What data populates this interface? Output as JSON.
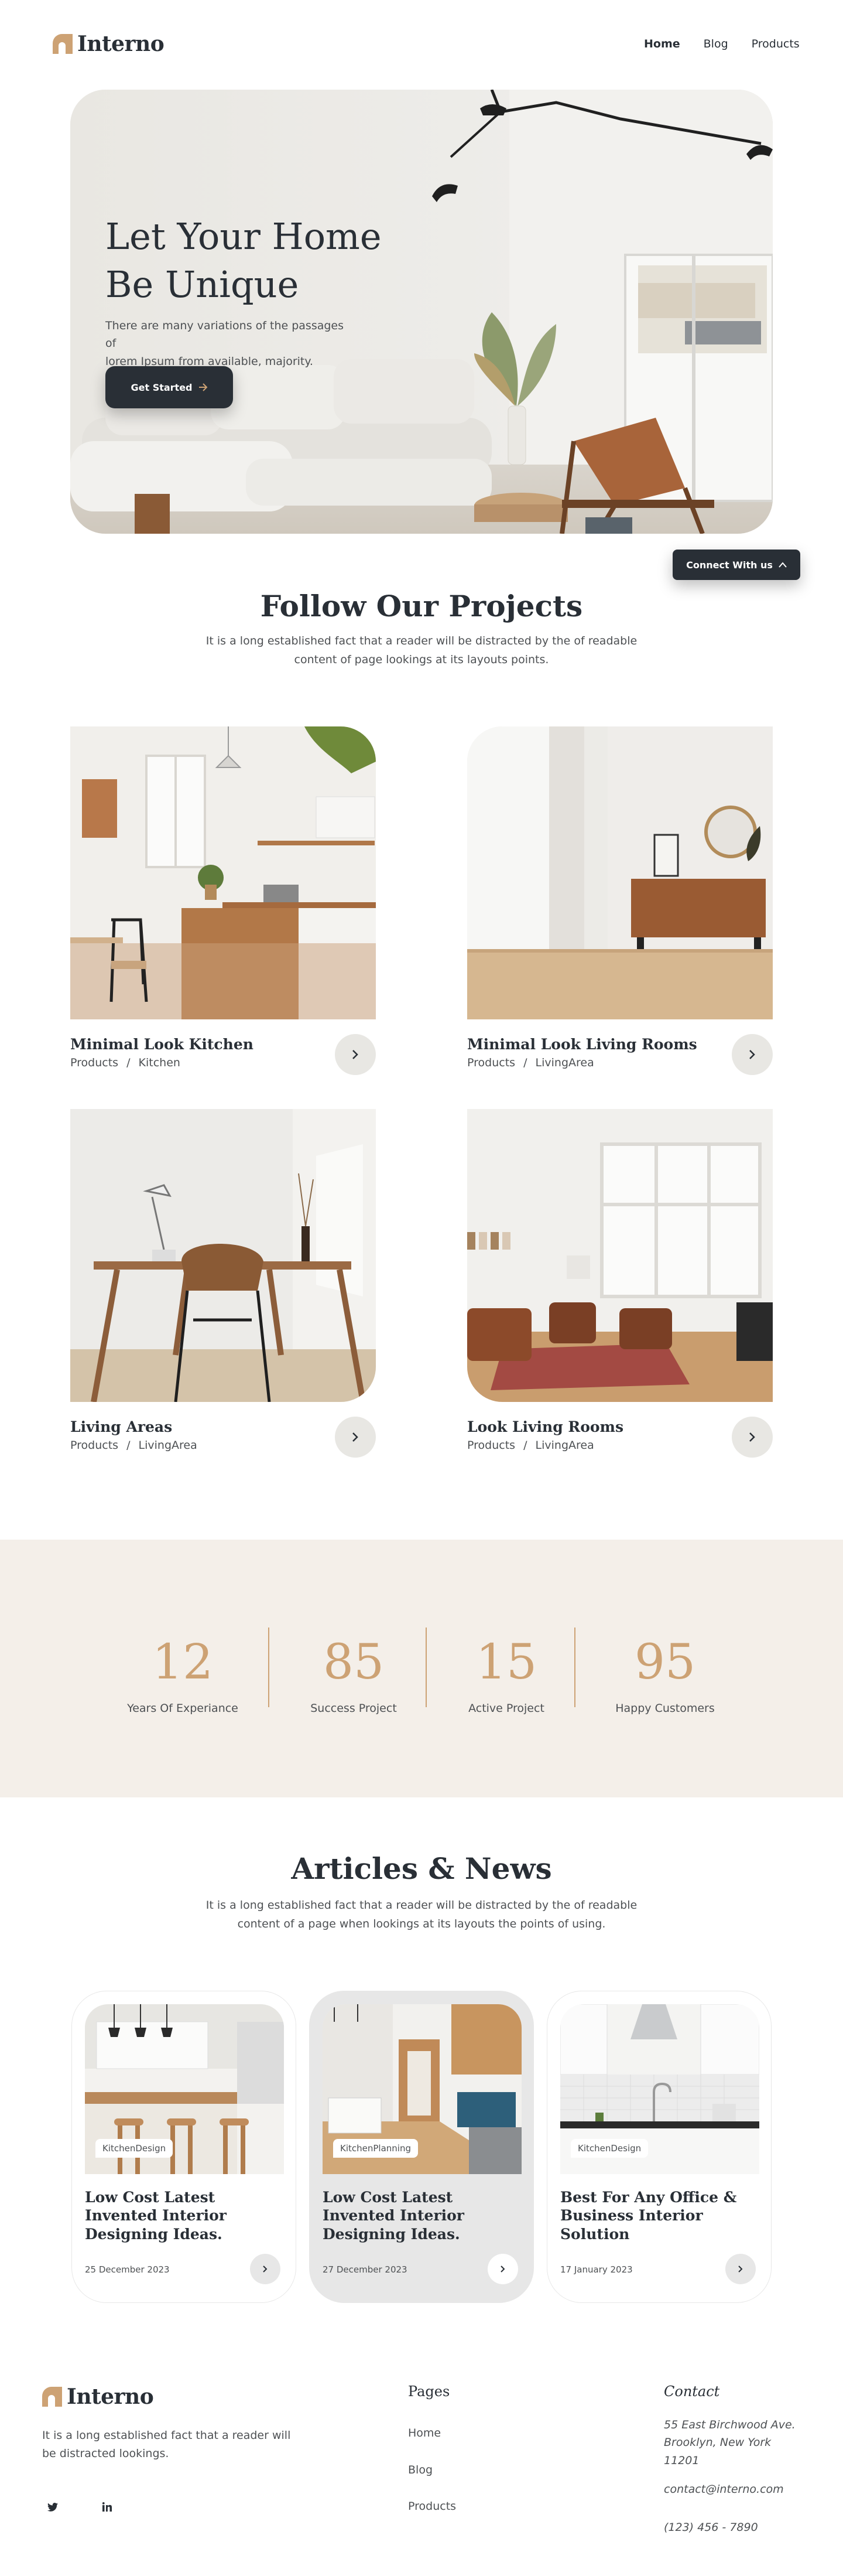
{
  "brand": {
    "name": "Interno",
    "accent": "#cda274",
    "dark": "#292f36"
  },
  "nav": {
    "items": [
      "Home",
      "Blog",
      "Products"
    ],
    "active": "Home"
  },
  "hero": {
    "title_line1": "Let Your Home",
    "title_line2": "Be Unique",
    "text_line1": "There are many variations of the passages of",
    "text_line2": "lorem Ipsum from available, majority.",
    "cta": "Get Started"
  },
  "connect": {
    "label": "Connect With us"
  },
  "projects": {
    "title": "Follow Our Projects",
    "sub_line1": "It is a long established fact that a reader will be distracted by the of readable",
    "sub_line2": "content of page lookings at its layouts points.",
    "items": [
      {
        "name": "Minimal Look Kitchen",
        "cat": "Products",
        "sub": "Kitchen"
      },
      {
        "name": "Minimal Look Living Rooms",
        "cat": "Products",
        "sub": "LivingArea"
      },
      {
        "name": "Living Areas",
        "cat": "Products",
        "sub": "LivingArea"
      },
      {
        "name": "Look Living Rooms",
        "cat": "Products",
        "sub": "LivingArea"
      }
    ],
    "separator": "/"
  },
  "stats": [
    {
      "num": "12",
      "label": "Years Of Experiance"
    },
    {
      "num": "85",
      "label": "Success Project"
    },
    {
      "num": "15",
      "label": "Active Project"
    },
    {
      "num": "95",
      "label": "Happy Customers"
    }
  ],
  "articles": {
    "title": "Articles & News",
    "sub_line1": "It is a long established fact that a reader will be distracted by the of readable",
    "sub_line2": "content of a page when lookings at its layouts the points of using.",
    "items": [
      {
        "tag": "KitchenDesign",
        "title": "Low Cost Latest Invented Interior Designing Ideas.",
        "date": "25 December 2023"
      },
      {
        "tag": "KitchenPlanning",
        "title": "Low Cost Latest Invented Interior Designing Ideas.",
        "date": "27 December 2023"
      },
      {
        "tag": "KitchenDesign",
        "title": "Best For Any Office & Business Interior Solution",
        "date": "17 January 2023"
      }
    ]
  },
  "footer": {
    "about_line1": "It is a long established fact that a reader will",
    "about_line2": "be distracted lookings.",
    "social": [
      "twitter-icon",
      "linkedin-icon"
    ],
    "pages_title": "Pages",
    "pages": [
      "Home",
      "Blog",
      "Products"
    ],
    "contact_title": "Contact",
    "address_line1": "55 East Birchwood Ave.",
    "address_line2": "Brooklyn, New York",
    "address_line3": "11201",
    "email": "contact@interno.com",
    "phone": "(123) 456 - 7890"
  }
}
